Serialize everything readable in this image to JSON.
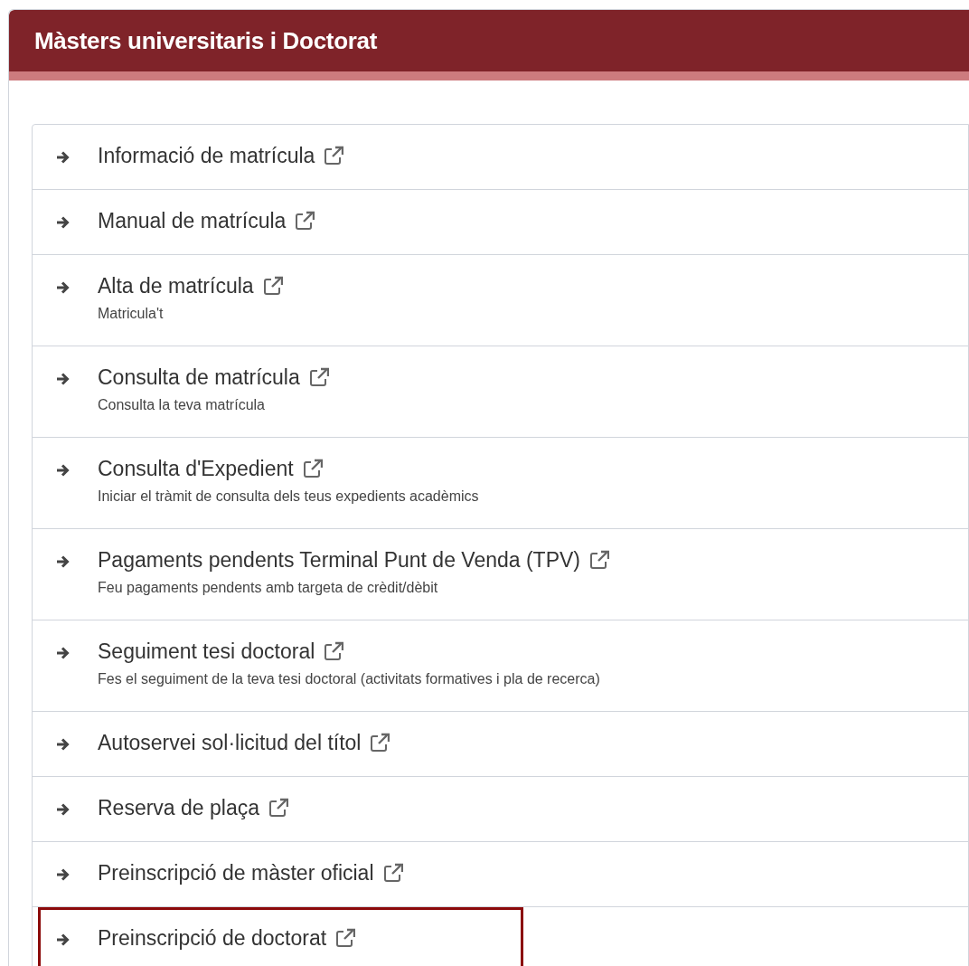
{
  "panel": {
    "title": "Màsters universitaris i Doctorat"
  },
  "items": [
    {
      "label": "Informació de matrícula",
      "highlighted": false
    },
    {
      "label": "Manual de matrícula",
      "highlighted": false
    },
    {
      "label": "Alta de matrícula",
      "description": "Matricula't",
      "highlighted": false
    },
    {
      "label": "Consulta de matrícula",
      "description": "Consulta la teva matrícula",
      "highlighted": false
    },
    {
      "label": "Consulta d'Expedient",
      "description": "Iniciar el tràmit de consulta dels teus expedients acadèmics",
      "highlighted": false
    },
    {
      "label": "Pagaments pendents Terminal Punt de Venda (TPV)",
      "description": "Feu pagaments pendents amb targeta de crèdit/dèbit",
      "highlighted": false
    },
    {
      "label": "Seguiment tesi doctoral",
      "description": "Fes el seguiment de la teva tesi doctoral (activitats formatives i pla de recerca)",
      "highlighted": false
    },
    {
      "label": "Autoservei sol·licitud del títol",
      "highlighted": false
    },
    {
      "label": "Reserva de plaça",
      "highlighted": false
    },
    {
      "label": "Preinscripció de màster oficial",
      "highlighted": false
    },
    {
      "label": "Preinscripció de doctorat",
      "highlighted": true
    }
  ]
}
